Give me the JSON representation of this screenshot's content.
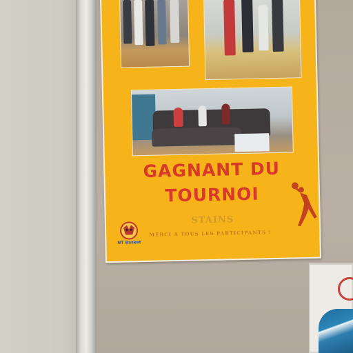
{
  "poster": {
    "title_line1": "GAGNANT DU",
    "title_line2": "TOURNOI",
    "location": "STAINS",
    "thanks": "MERCI A TOUS LES PARTICIPANTS !",
    "logo_text": "NT Basket"
  },
  "colors": {
    "poster_background": "#f7b41a",
    "title": "#d8392b",
    "board": "#b8aea3"
  },
  "icons": [
    "team-logo-icon",
    "basketball-player-icon",
    "sign-circle-icon"
  ]
}
